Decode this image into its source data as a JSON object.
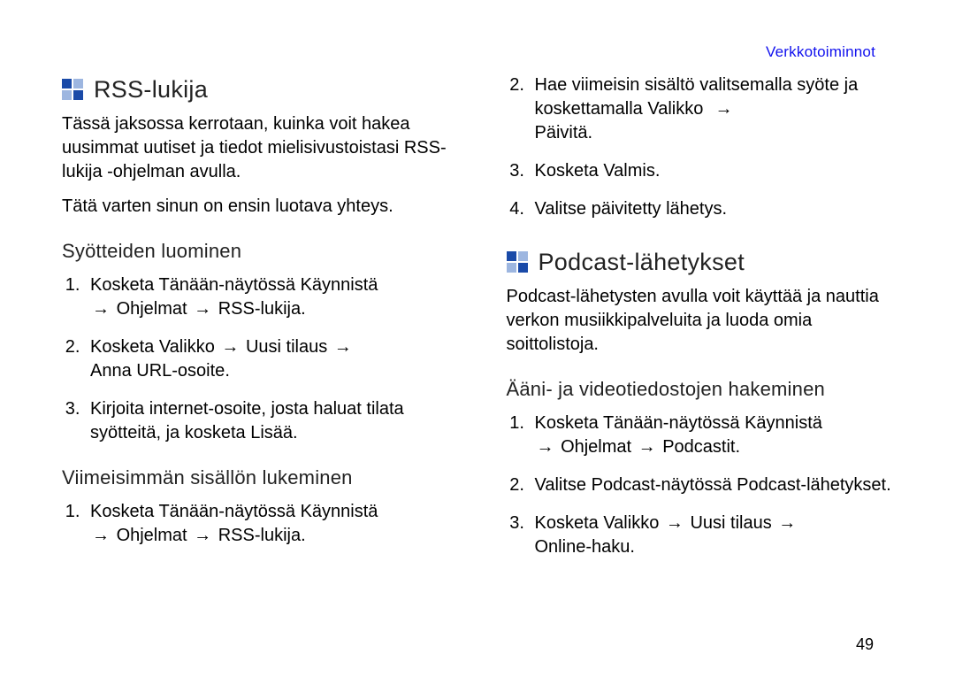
{
  "header": {
    "section_label": "Verkkotoiminnot"
  },
  "page_number": "49",
  "arrow": "→",
  "left": {
    "rss": {
      "title": "RSS-lukija",
      "intro1": "Tässä jaksossa kerrotaan, kuinka voit hakea uusimmat uutiset ja tiedot mielisivustoistasi RSS-lukija -ohjelman avulla.",
      "intro2": "Tätä varten sinun on ensin luotava yhteys.",
      "sub1": "Syötteiden luominen",
      "s1_1_a": "Kosketa Tänään-näytössä ",
      "s1_1_b": "Käynnistä",
      "s1_1_c": "Ohjelmat",
      "s1_1_d": "RSS-lukija",
      "s1_2_a": "Kosketa ",
      "s1_2_b": "Valikko",
      "s1_2_c": "Uusi tilaus",
      "s1_2_d": "Anna URL-osoite",
      "s1_3_a": "Kirjoita internet-osoite, josta haluat tilata syötteitä, ja kosketa ",
      "s1_3_b": "Lisää",
      "sub2": "Viimeisimmän sisällön lukeminen",
      "s2_1_a": "Kosketa Tänään-näytössä ",
      "s2_1_b": "Käynnistä",
      "s2_1_c": "Ohjelmat",
      "s2_1_d": "RSS-lukija"
    }
  },
  "right": {
    "rss_cont": {
      "c2_a": "Hae viimeisin sisältö valitsemalla syöte ja koskettamalla ",
      "c2_b": "Valikko",
      "c2_c": "Päivitä",
      "c3_a": "Kosketa ",
      "c3_b": "Valmis",
      "c4": "Valitse päivitetty lähetys."
    },
    "podcast": {
      "title": "Podcast-lähetykset",
      "intro": "Podcast-lähetysten avulla voit käyttää ja nauttia verkon musiikkipalveluita ja luoda omia soittolistoja.",
      "sub1": "Ääni- ja videotiedostojen hakeminen",
      "p1_a": "Kosketa Tänään-näytössä ",
      "p1_b": "Käynnistä",
      "p1_c": "Ohjelmat",
      "p1_d": "Podcastit",
      "p2_a": "Valitse Podcast-näytössä ",
      "p2_b": "Podcast-lähetykset",
      "p3_a": "Kosketa ",
      "p3_b": "Valikko",
      "p3_c": "Uusi tilaus",
      "p3_d": "Online-haku"
    }
  }
}
